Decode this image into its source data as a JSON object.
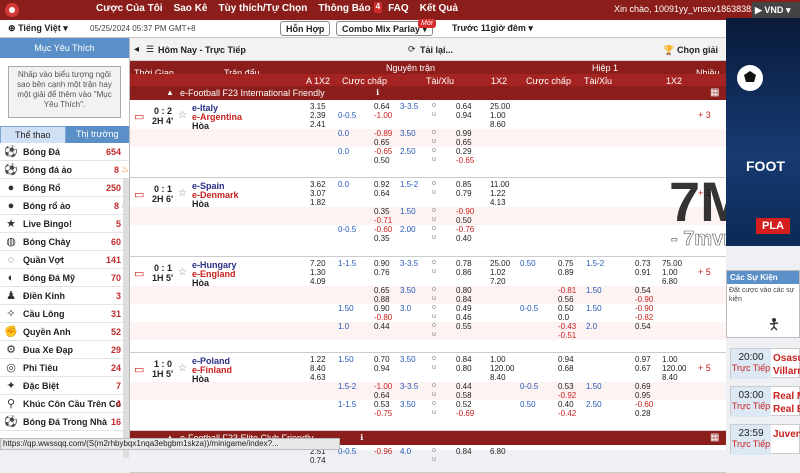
{
  "topbar": {
    "nav": [
      "Cược Của Tôi",
      "Sao Kê",
      "Tùy thích/Tự Chọn",
      "Thông Báo",
      "FAQ",
      "Kết Quả"
    ],
    "notify_count": "4",
    "user": "Xin chào, 10091yy_vnsxv18638382",
    "currency": "VND"
  },
  "subbar": {
    "language": "Tiếng Việt",
    "datetime": "05/25/2024 05:37 PM GMT+8",
    "btn_mixed": "Hỗn Hợp",
    "btn_combo": "Combo Mix Parlay",
    "new_badge": "Mới",
    "prev": "Trước 11giờ đêm",
    "pager": "1/1"
  },
  "left": {
    "fav_title": "Mục Yêu Thích",
    "fav_hint": "Nhấp vào biểu tượng ngôi sao bên cạnh một trận hay một giải để thêm vào \"Mục Yêu Thích\".",
    "tabs": [
      "Thể thao",
      "Thị trường"
    ],
    "sports": [
      {
        "name": "Bóng Đá",
        "count": "654",
        "icon": "soccer-ball-icon",
        "fire": false
      },
      {
        "name": "Bóng đá ảo",
        "count": "8",
        "icon": "virtual-soccer-icon",
        "fire": true
      },
      {
        "name": "Bóng Rổ",
        "count": "250",
        "icon": "basketball-icon",
        "fire": false
      },
      {
        "name": "Bóng rổ ảo",
        "count": "8",
        "icon": "virtual-basketball-icon",
        "fire": true
      },
      {
        "name": "Live Bingo!",
        "count": "5",
        "icon": "bingo-icon",
        "fire": false
      },
      {
        "name": "Bóng Chày",
        "count": "60",
        "icon": "baseball-icon",
        "fire": false
      },
      {
        "name": "Quần Vợt",
        "count": "141",
        "icon": "tennis-icon",
        "fire": false
      },
      {
        "name": "Bóng Đá Mỹ",
        "count": "70",
        "icon": "american-football-icon",
        "fire": false
      },
      {
        "name": "Điền Kinh",
        "count": "3",
        "icon": "athletics-icon",
        "fire": false
      },
      {
        "name": "Cầu Lông",
        "count": "31",
        "icon": "badminton-icon",
        "fire": false
      },
      {
        "name": "Quyền Anh",
        "count": "52",
        "icon": "boxing-icon",
        "fire": false
      },
      {
        "name": "Đua Xe Đạp",
        "count": "29",
        "icon": "cycling-icon",
        "fire": false
      },
      {
        "name": "Phi Tiêu",
        "count": "24",
        "icon": "darts-icon",
        "fire": false
      },
      {
        "name": "Đặc Biệt",
        "count": "7",
        "icon": "special-icon",
        "fire": false
      },
      {
        "name": "Khúc Côn Cầu Trên Cỏ",
        "count": "4",
        "icon": "field-hockey-icon",
        "fire": false
      },
      {
        "name": "Bóng Đá Trong Nhà",
        "count": "16",
        "icon": "futsal-icon",
        "fire": false
      }
    ]
  },
  "main": {
    "header_left": "Hôm Nay - Trực Tiếp",
    "header_mid": "Tải lại...",
    "header_right": "Chọn giải",
    "col_time": "Thời Gian",
    "col_match": "Trận đấu",
    "col_full": "Nguyên trận",
    "col_half": "Hiệp 1",
    "col_more": "Nhiều",
    "sub_cols": [
      "A 1X2",
      "Cược chấp",
      "Tài/Xỉu",
      "1X2",
      "Cược chấp",
      "Tài/Xỉu",
      "1X2"
    ],
    "leagues": [
      "e-Football F23 International Friendly",
      "e-Football F23 Elite Club Friendly"
    ],
    "matches": [
      {
        "score": "0 : 2",
        "time": "2H 4'",
        "home": "e-Italy",
        "away": "e-Argentina",
        "draw": "Hòa",
        "more": "+ 3",
        "x12": [
          "3.15",
          "2.39",
          "2.41"
        ],
        "lines": [
          {
            "hcap": "",
            "h1": "0.64",
            "h2": "-1.00",
            "ou": "3-3.5",
            "o1": "0.64",
            "o2": "0.94",
            "x1": "25.00",
            "x2": "1.00",
            "x3": "8.60"
          },
          {
            "hcap": "0.0",
            "h1": "-0.89",
            "h2": "0.65",
            "ou": "3.50",
            "o1": "0.99",
            "o2": "0.65"
          },
          {
            "hcap": "0.0",
            "h1": "-0.65",
            "h2": "0.50",
            "ou": "2.50",
            "o1": "0.29",
            "o2": "-0.65"
          }
        ],
        "hcap_home": "0-0.5"
      },
      {
        "score": "0 : 1",
        "time": "2H 6'",
        "home": "e-Spain",
        "away": "e-Denmark",
        "draw": "Hòa",
        "more": "+ 3",
        "x12": [
          "3.62",
          "3.07",
          "1.82"
        ],
        "lines": [
          {
            "hcap": "0.0",
            "h1": "0.92",
            "h2": "0.64",
            "ou": "1.5-2",
            "o1": "0.85",
            "o2": "0.79",
            "x1": "11.00",
            "x2": "1.22",
            "x3": "4.13"
          },
          {
            "hcap": "",
            "h1": "0.35",
            "h2": "-0.71",
            "ou": "1.50",
            "o1": "-0.90",
            "o2": "0.50"
          },
          {
            "hcap": "0-0.5",
            "h1": "-0.60",
            "h2": "0.35",
            "ou": "2.00",
            "o1": "-0.76",
            "o2": "0.40"
          }
        ],
        "hcap_home": ""
      },
      {
        "score": "0 : 1",
        "time": "1H 5'",
        "home": "e-Hungary",
        "away": "e-England",
        "draw": "Hòa",
        "more": "+ 5",
        "x12": [
          "7.20",
          "1.30",
          "4.09"
        ],
        "lines": [
          {
            "hcap": "1-1.5",
            "h1": "0.90",
            "h2": "0.76",
            "ou": "3-3.5",
            "o1": "0.78",
            "o2": "0.86",
            "x1": "25.00",
            "x2": "1.02",
            "x3": "7.20",
            "hh": "0.50",
            "hh1": "0.75",
            "hh2": "0.89",
            "hou": "1.5-2",
            "ho1": "0.73",
            "ho2": "0.91",
            "hx1": "75.00",
            "hx2": "1.00",
            "hx3": "6.80"
          },
          {
            "hcap": "",
            "h1": "0.65",
            "h2": "0.88",
            "ou": "3.50",
            "o1": "0.80",
            "o2": "0.84",
            "hh": "",
            "hh1": "-0.81",
            "hh2": "0.56",
            "hou": "1.50",
            "ho1": "0.54",
            "ho2": "-0.90"
          },
          {
            "hcap": "1.50",
            "h1": "0.90",
            "h2": "-0.80",
            "ou": "3.0",
            "o1": "0.49",
            "o2": "0.46",
            "hh": "0-0.5",
            "hh1": "0.50",
            "hh2": "0.0",
            "hou": "1.50",
            "ho1": "-0.90",
            "ho2": "-0.82"
          },
          {
            "hcap": "1.0",
            "h1": "0.44",
            "h2": "",
            "ou": "",
            "o1": "0.55",
            "o2": "",
            "hh": "",
            "hh1": "-0.43",
            "hh2": "-0.51",
            "hou": "2.0",
            "ho1": "0.54",
            "ho2": ""
          }
        ]
      },
      {
        "score": "1 : 0",
        "time": "1H 5'",
        "home": "e-Poland",
        "away": "e-Finland",
        "draw": "Hòa",
        "more": "+ 5",
        "x12": [
          "1.22",
          "8.40",
          "4.63"
        ],
        "lines": [
          {
            "hcap": "1.50",
            "h1": "0.70",
            "h2": "0.94",
            "ou": "3.50",
            "o1": "0.84",
            "o2": "0.80",
            "x1": "1.00",
            "x2": "120.00",
            "x3": "8.40",
            "hh": "",
            "hh1": "0.94",
            "hh2": "0.68",
            "hou": "",
            "ho1": "0.97",
            "ho2": "0.67",
            "hx1": "1.00",
            "hx2": "120.00",
            "hx3": "8.40"
          },
          {
            "hcap": "1.5-2",
            "h1": "-1.00",
            "h2": "0.64",
            "ou": "3-3.5",
            "o1": "0.44",
            "o2": "0.58",
            "hh": "0-0.5",
            "hh1": "0.53",
            "hh2": "-0.92",
            "hou": "1.50",
            "ho1": "0.69",
            "ho2": "0.95"
          },
          {
            "hcap": "1-1.5",
            "h1": "0.53",
            "h2": "-0.75",
            "ou": "3.50",
            "o1": "0.52",
            "o2": "-0.69",
            "hh": "0.50",
            "hh1": "0.40",
            "hh2": "-0.42",
            "hou": "2.50",
            "ho1": "-0.60",
            "ho2": "0.28"
          }
        ]
      },
      {
        "score": "",
        "time": "",
        "home": "",
        "away": "",
        "draw": "",
        "more": "",
        "x12": [
          "2.51",
          "0.74"
        ],
        "lines": [
          {
            "hcap": "0-0.5",
            "h1": "-0.96",
            "h2": "",
            "ou": "4.0",
            "o1": "0.84",
            "o2": "",
            "x1": "6.80",
            "x2": "",
            "x3": ""
          }
        ]
      }
    ]
  },
  "right": {
    "ad_text": "FOOT",
    "ad_button": "PLA",
    "promo_title": "Các Sự Kiện",
    "promo_body": "Đặt cược vào các sự kiện",
    "live": [
      {
        "time": "20:00",
        "label": "Trực Tiếp",
        "t1": "Osasu",
        "t2": "Villarr"
      },
      {
        "time": "03:00",
        "label": "Trực Tiếp",
        "t1": "Real M",
        "t2": "Real E"
      },
      {
        "time": "23:59",
        "label": "Trực Tiếp",
        "t1": "Juven",
        "t2": ""
      }
    ]
  },
  "watermark": "7mvn.co",
  "status_url": "https://qp.wwssqq.com/(S(m2rhbybqx1nqa3ebgbm1skza))/minigame/index?..."
}
